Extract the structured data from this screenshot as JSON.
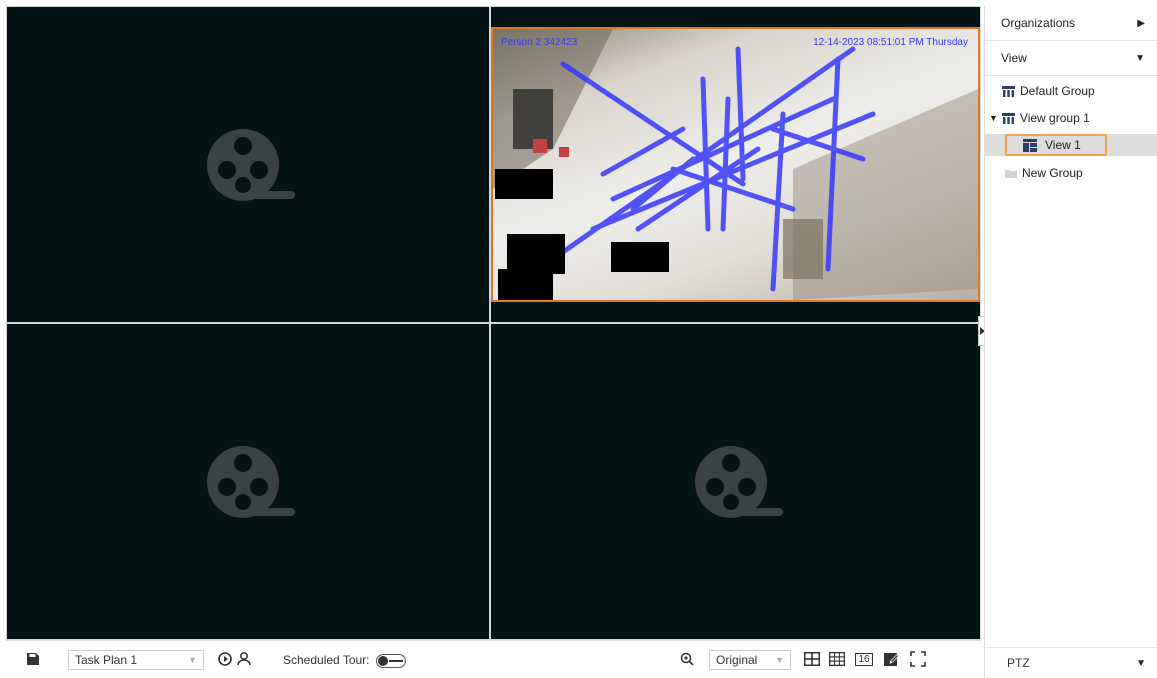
{
  "cameras": {
    "feed": {
      "osd_name": "Person 2",
      "osd_id": "342423",
      "osd_timestamp": "12-14-2023 08:51:01 PM Thursday"
    }
  },
  "toolbar": {
    "task_plan": "Task Plan 1",
    "scheduled_tour_label": "Scheduled Tour:",
    "zoom_mode": "Original",
    "grid16_label": "16"
  },
  "panel": {
    "organizations": "Organizations",
    "view": "View",
    "tree": {
      "default_group": "Default Group",
      "view_group_1": "View group 1",
      "view_1": "View 1",
      "new_group": "New Group"
    },
    "ptz": "PTZ"
  },
  "colors": {
    "wall_bg": "#041414",
    "selection_border": "#e0782a",
    "highlight_box": "#f2a14a",
    "track_lines": "#3838ff"
  },
  "icons": [
    "film-reel-icon",
    "save-icon",
    "refresh-icon",
    "user-tour-icon",
    "zoom-icon",
    "layout-4-icon",
    "layout-9-icon",
    "layout-16-icon",
    "custom-layout-icon",
    "fullscreen-icon",
    "view-group-icon",
    "layout-view-icon",
    "folder-icon"
  ]
}
